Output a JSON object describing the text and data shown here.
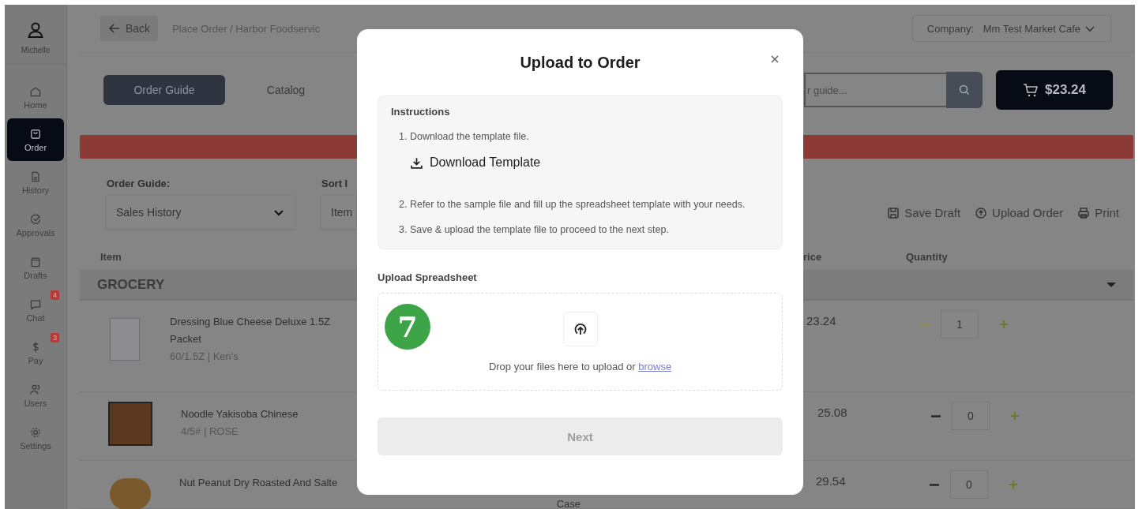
{
  "sidebar": {
    "user": {
      "name": "Michelle"
    },
    "items": [
      {
        "label": "Home",
        "selected": false
      },
      {
        "label": "Order",
        "selected": true
      },
      {
        "label": "History",
        "selected": false
      },
      {
        "label": "Approvals",
        "selected": false
      },
      {
        "label": "Drafts",
        "selected": false
      },
      {
        "label": "Chat",
        "selected": false,
        "badge": "4"
      },
      {
        "label": "Pay",
        "selected": false,
        "badge": "3"
      },
      {
        "label": "Users",
        "selected": false
      },
      {
        "label": "Settings",
        "selected": false
      }
    ]
  },
  "topbar": {
    "back": "Back",
    "breadcrumb": "Place Order / Harbor Foodservic",
    "company": {
      "label": "Company:",
      "value": "Mm Test Market Cafe"
    }
  },
  "tabs": [
    {
      "label": "Order Guide",
      "selected": true
    },
    {
      "label": "Catalog",
      "selected": false
    }
  ],
  "search": {
    "placeholder": "r guide..."
  },
  "cart": {
    "total": "$23.24"
  },
  "filters": [
    {
      "label": "Order Guide:",
      "value": "Sales History"
    },
    {
      "label": "Sort I",
      "value": "Item"
    }
  ],
  "actions": [
    {
      "label": "Save Draft"
    },
    {
      "label": "Upload Order"
    },
    {
      "label": "Print"
    }
  ],
  "table": {
    "columns": [
      "Item",
      "rice",
      "Quantity"
    ],
    "group": {
      "name": "GROCERY",
      "expanded": true
    },
    "rows": [
      {
        "name": "Dressing Blue Cheese Deluxe 1.5Z Packet",
        "detail": "60/1.5Z | Ken's",
        "price": "23.24",
        "quantity": "1"
      },
      {
        "name": "Noodle Yakisoba Chinese",
        "detail": "4/5# | ROSE",
        "price": "25.08",
        "quantity": "0"
      },
      {
        "name": "Nut Peanut Dry Roasted And Salte",
        "unit": "Case",
        "price": "29.54",
        "quantity": "0"
      }
    ]
  },
  "modal": {
    "title": "Upload to Order",
    "instructions": {
      "title": "Instructions",
      "steps": [
        {
          "text": "1. Download the template file.",
          "action": "Download Template"
        },
        {
          "text": "2. Refer to the sample file and fill up the spreadsheet template with your needs."
        },
        {
          "text": "3. Save & upload the template file to proceed to the next step."
        }
      ]
    },
    "upload": {
      "label": "Upload Spreadsheet",
      "prompt": "Drop your files here to upload or",
      "link": "browse"
    },
    "next": {
      "label": "Next",
      "disabled": true
    },
    "step_badge": "7"
  }
}
